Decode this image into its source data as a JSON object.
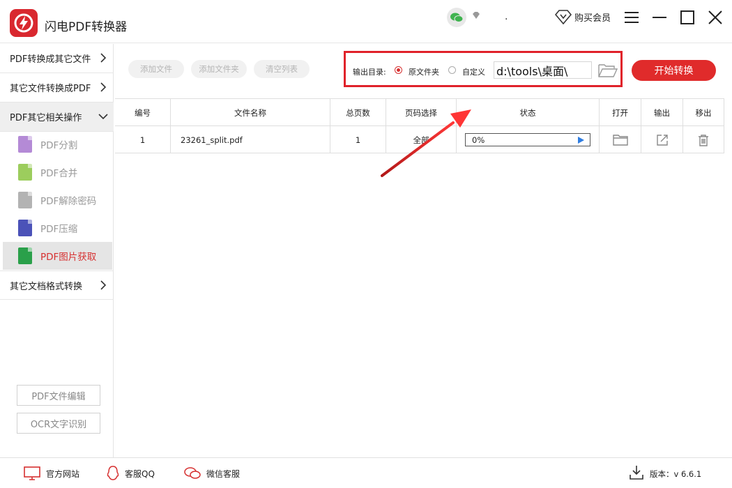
{
  "app": {
    "title": "闪电PDF转换器",
    "buy_vip": "购买会员",
    "dot": "."
  },
  "sidebar": {
    "cat_pdf_to_other": "PDF转换成其它文件",
    "cat_other_to_pdf": "其它文件转换成PDF",
    "cat_pdf_ops": "PDF其它相关操作",
    "ops_items": [
      {
        "label": "PDF分割",
        "color": "#b48ad6"
      },
      {
        "label": "PDF合并",
        "color": "#9ccd5d"
      },
      {
        "label": "PDF解除密码",
        "color": "#b3b3b3"
      },
      {
        "label": "PDF压缩",
        "color": "#4b52b8"
      },
      {
        "label": "PDF图片获取",
        "color": "#2aa04a"
      }
    ],
    "cat_other_doc": "其它文档格式转换",
    "btn_edit": "PDF文件编辑",
    "btn_ocr": "OCR文字识别"
  },
  "toolbar": {
    "add_file": "添加文件",
    "add_folder": "添加文件夹",
    "clear_list": "清空列表",
    "output_label": "输出目录:",
    "opt_original": "原文件夹",
    "opt_custom": "自定义",
    "path_value": "d:\\tools\\桌面\\",
    "start": "开始转换"
  },
  "table": {
    "headers": [
      "编号",
      "文件名称",
      "总页数",
      "页码选择",
      "状态",
      "打开",
      "输出",
      "移出"
    ],
    "rows": [
      {
        "index": "1",
        "name": "23261_split.pdf",
        "pages": "1",
        "range": "全部",
        "progress_text": "0%",
        "progress": 0
      }
    ]
  },
  "footer": {
    "website": "官方网站",
    "qq": "客服QQ",
    "wechat": "微信客服",
    "version": "版本：v 6.6.1"
  },
  "colors": {
    "accent": "#e02b2b",
    "annotation": "#e0222a",
    "play": "#2f7de1"
  }
}
